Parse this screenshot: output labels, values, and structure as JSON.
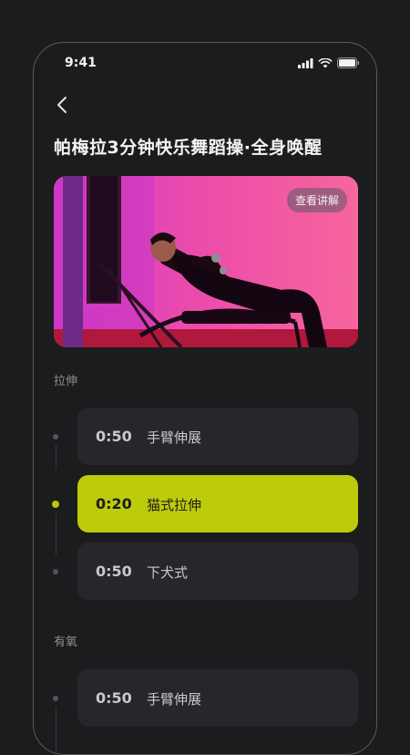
{
  "status_bar": {
    "time": "9:41"
  },
  "page": {
    "title": "帕梅拉3分钟快乐舞蹈操·全身唤醒"
  },
  "hero": {
    "explain_label": "查看讲解"
  },
  "sections": [
    {
      "label": "拉伸",
      "items": [
        {
          "duration": "0:50",
          "name": "手臂伸展",
          "active": false
        },
        {
          "duration": "0:20",
          "name": "猫式拉伸",
          "active": true
        },
        {
          "duration": "0:50",
          "name": "下犬式",
          "active": false
        }
      ]
    },
    {
      "label": "有氧",
      "items": [
        {
          "duration": "0:50",
          "name": "手臂伸展",
          "active": false
        }
      ]
    }
  ],
  "colors": {
    "accent": "#bccb0a",
    "background": "#1b1c1e",
    "card": "#26272a"
  }
}
